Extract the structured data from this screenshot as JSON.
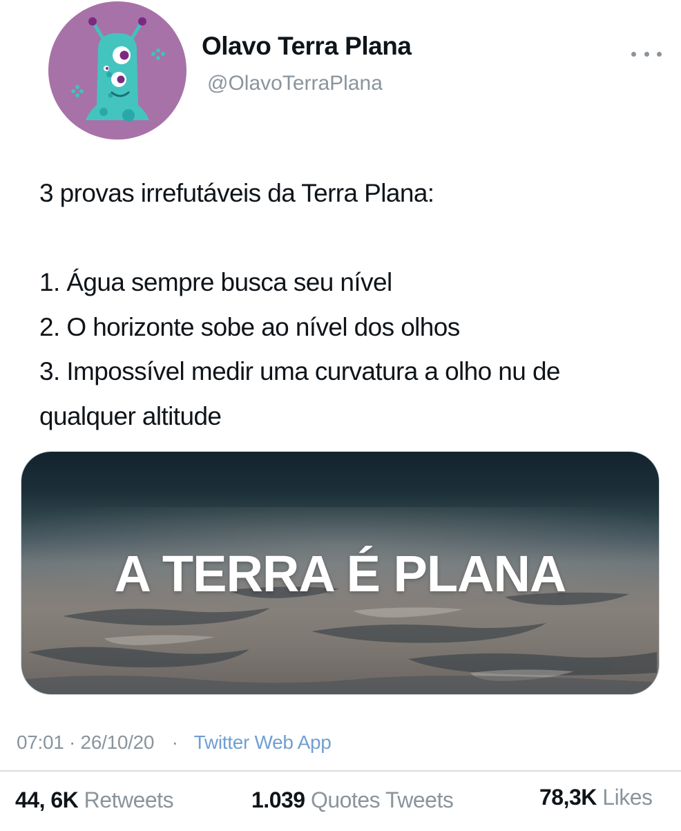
{
  "tweet": {
    "display_name": "Olavo Terra Plana",
    "handle": "@OlavoTerraPlana",
    "more_icon": "more-horizontal-icon",
    "text_lines": [
      "3 provas irrefutáveis da Terra Plana:",
      "",
      "1. Água sempre busca seu nível",
      "2. O horizonte sobe ao nível dos olhos",
      "3. Impossível medir uma curvatura a olho nu de",
      "qualquer altitude"
    ],
    "media_caption": "A TERRA É PLANA",
    "time": "07:01 · 26/10/20",
    "separator": "·",
    "source": "Twitter Web App"
  },
  "stats": {
    "retweets_count": "44, 6K",
    "retweets_label": "Retweets",
    "quotes_count": "1.039",
    "quotes_label": "Quotes Tweets",
    "likes_count": "78,3K",
    "likes_label": "Likes"
  },
  "colors": {
    "avatar_bg": "#a772a8",
    "muted_text": "#8a949c",
    "link": "#6f9fd1"
  }
}
